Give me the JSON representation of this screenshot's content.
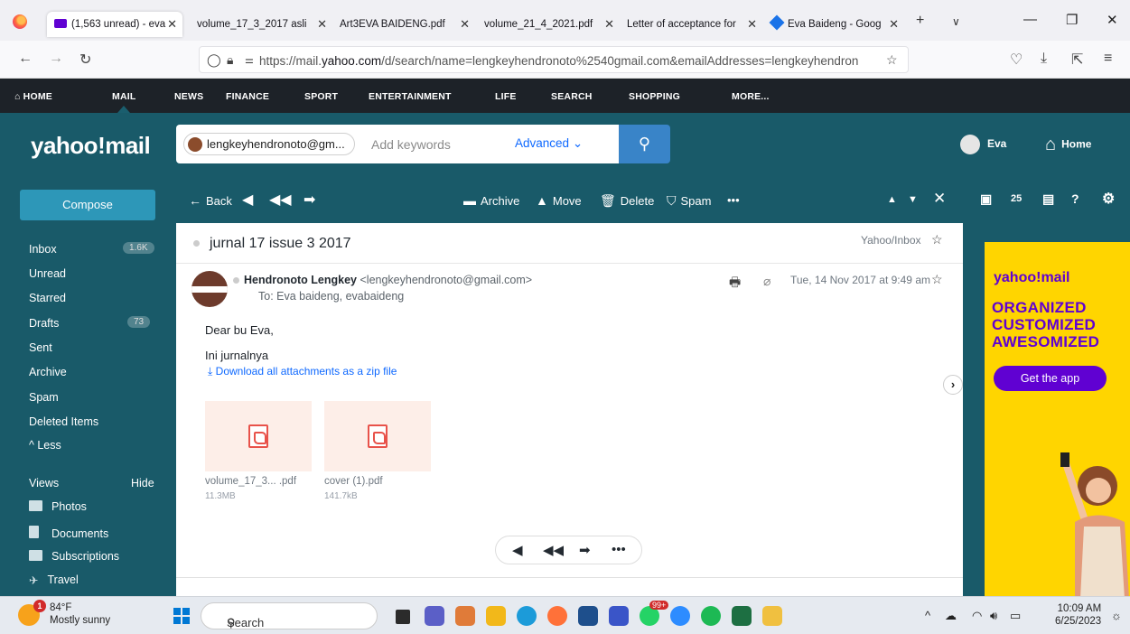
{
  "browser": {
    "tabs": [
      {
        "label": "(1,563 unread) - eva",
        "active": true
      },
      {
        "label": "volume_17_3_2017 asli",
        "active": false
      },
      {
        "label": "Art3EVA BAIDENG.pdf",
        "active": false
      },
      {
        "label": "volume_21_4_2021.pdf",
        "active": false
      },
      {
        "label": "Letter of acceptance for",
        "active": false
      },
      {
        "label": "Eva Baideng - Goog",
        "active": false
      }
    ],
    "url_prefix": "https://mail.",
    "url_domain": "yahoo.com",
    "url_rest": "/d/search/name=lengkeyhendronoto%2540gmail.com&emailAddresses=lengkeyhendron"
  },
  "topnav": {
    "items": [
      "HOME",
      "MAIL",
      "NEWS",
      "FINANCE",
      "SPORT",
      "ENTERTAINMENT",
      "LIFE",
      "SEARCH",
      "SHOPPING",
      "MORE..."
    ]
  },
  "header": {
    "logo": "yahoo!mail",
    "search_chip": "lengkeyhendronoto@gm...",
    "search_placeholder": "Add keywords",
    "advanced": "Advanced",
    "user": "Eva",
    "home": "Home"
  },
  "sidebar": {
    "compose": "Compose",
    "folders": [
      {
        "label": "Inbox",
        "count": "1.6K"
      },
      {
        "label": "Unread",
        "count": ""
      },
      {
        "label": "Starred",
        "count": ""
      },
      {
        "label": "Drafts",
        "count": "73"
      },
      {
        "label": "Sent",
        "count": ""
      },
      {
        "label": "Archive",
        "count": ""
      },
      {
        "label": "Spam",
        "count": ""
      },
      {
        "label": "Deleted Items",
        "count": ""
      }
    ],
    "less": "^ Less",
    "views_label": "Views",
    "hide": "Hide",
    "views": [
      "Photos",
      "Documents",
      "Subscriptions",
      "Travel"
    ]
  },
  "toolbar": {
    "back": "Back",
    "archive": "Archive",
    "move": "Move",
    "delete": "Delete",
    "spam": "Spam",
    "more": "•••"
  },
  "email": {
    "subject": "jurnal 17 issue 3 2017",
    "folder": "Yahoo/Inbox",
    "sender_name": "Hendronoto Lengkey",
    "sender_email": "<lengkeyhendronoto@gmail.com>",
    "to": "To: Eva baideng,  evabaideng",
    "date": "Tue, 14 Nov 2017 at 9:49 am",
    "greeting": "Dear bu Eva,",
    "body": "Ini jurnalnya",
    "download_all": "Download all attachments as a zip file",
    "attachments": [
      {
        "name": "volume_17_3... .pdf",
        "size": "11.3MB"
      },
      {
        "name": "cover (1).pdf",
        "size": "141.7kB"
      }
    ]
  },
  "ad": {
    "logo": "yahoo!mail",
    "lines": [
      "ORGANIZED",
      "CUSTOMIZED",
      "AWESOMIZED"
    ],
    "button": "Get the app"
  },
  "taskbar": {
    "temp": "84°F",
    "weather": "Mostly sunny",
    "weather_badge": "1",
    "search": "Search",
    "time": "10:09 AM",
    "date": "6/25/2023",
    "whatsapp_badge": "99+"
  }
}
